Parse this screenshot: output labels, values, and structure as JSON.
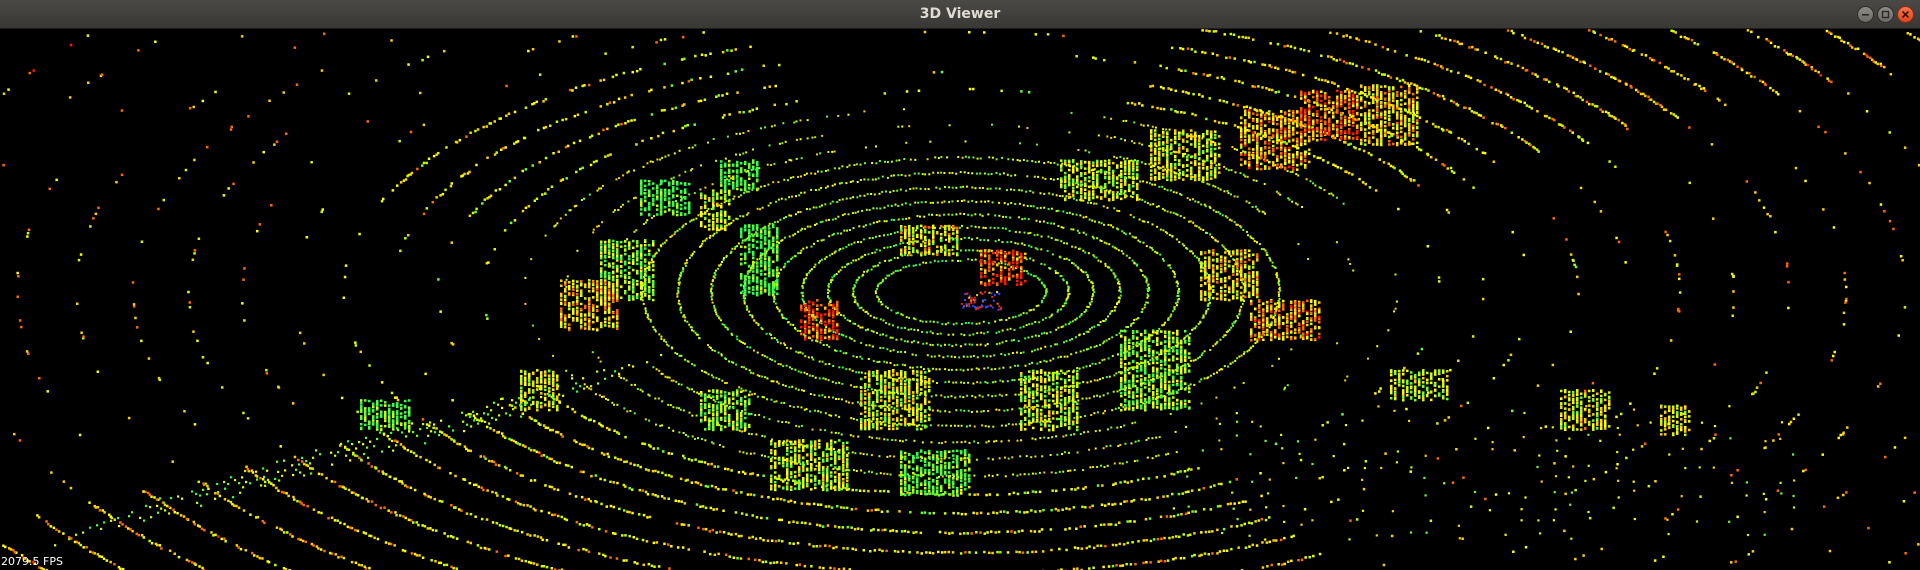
{
  "window": {
    "title": "3D Viewer",
    "controls": {
      "minimize_icon": "minimize-icon",
      "maximize_icon": "maximize-icon",
      "close_icon": "close-icon"
    }
  },
  "viewer": {
    "fps_text": "2079.5 FPS",
    "background_color": "#000000",
    "point_colors": [
      "#ff1a00",
      "#ff6a00",
      "#ffd000",
      "#ffff00",
      "#c8ff00",
      "#66ff33",
      "#2bff4d"
    ]
  }
}
